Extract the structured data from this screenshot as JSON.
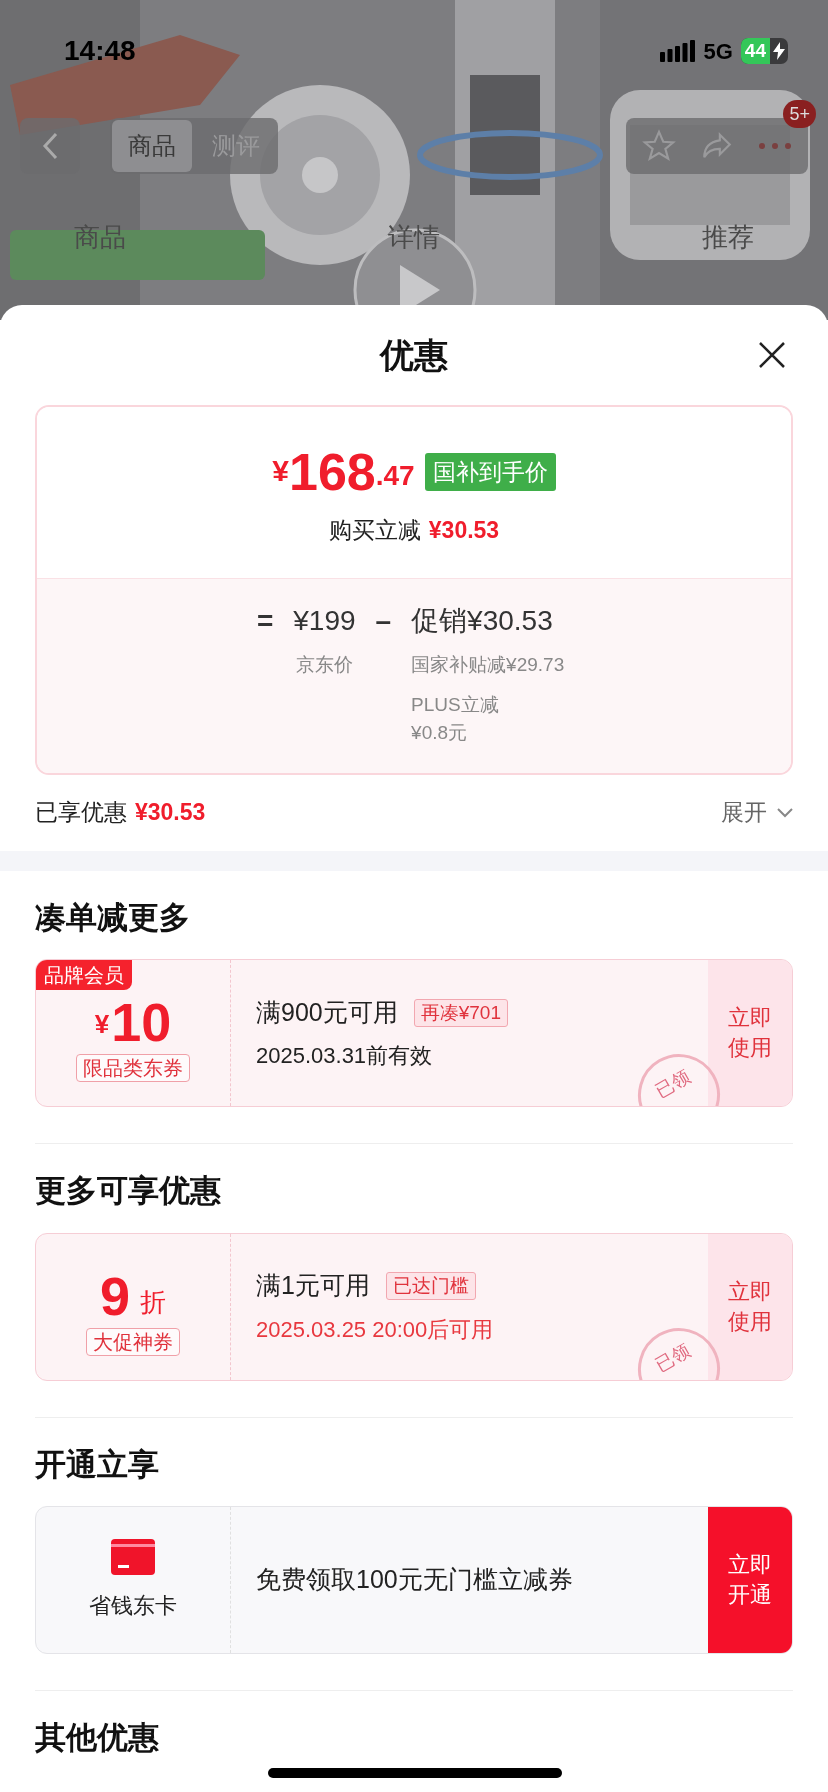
{
  "status_bar": {
    "time": "14:48",
    "network": "5G",
    "battery": "44",
    "charging": true
  },
  "product_header": {
    "tabs": [
      {
        "label": "商品",
        "selected": true
      },
      {
        "label": "测评",
        "selected": false
      }
    ],
    "badge": "5+",
    "nav": [
      {
        "label": "商品"
      },
      {
        "label": "详情"
      },
      {
        "label": "推荐"
      }
    ]
  },
  "sheet": {
    "title": "优惠",
    "price": {
      "currency": "¥",
      "integer": "168",
      "decimal": ".47",
      "tag": "国补到手价",
      "saving_label": "购买立减",
      "saving_value": "¥30.53"
    },
    "breakdown": {
      "equals": "=",
      "base_value": "¥199",
      "base_label": "京东价",
      "minus": "–",
      "promo": "促销¥30.53",
      "details": [
        {
          "lines": [
            "国家补贴减¥29.73"
          ]
        },
        {
          "lines": [
            "PLUS立减",
            "¥0.8元"
          ]
        }
      ]
    },
    "summary": {
      "label": "已享优惠",
      "value": "¥30.53",
      "toggle": "展开"
    },
    "sections": [
      {
        "title": "凑单减更多",
        "cards": [
          {
            "kind": "coupon",
            "ribbon": "品牌会员",
            "prefix": "¥",
            "value": "10",
            "tag": "限品类东券",
            "condition": "满900元可用",
            "chip": "再凑¥701",
            "validity": "2025.03.31前有效",
            "validity_highlight": false,
            "button": [
              "立即",
              "使用"
            ],
            "stamp": "已领"
          }
        ]
      },
      {
        "title": "更多可享优惠",
        "cards": [
          {
            "kind": "coupon",
            "value": "9",
            "suffix": "折",
            "tag": "大促神券",
            "condition": "满1元可用",
            "chip": "已达门槛",
            "validity": "2025.03.25 20:00后可用",
            "validity_highlight": true,
            "button": [
              "立即",
              "使用"
            ],
            "stamp": "已领"
          }
        ]
      },
      {
        "title": "开通立享",
        "cards": [
          {
            "kind": "membership",
            "name": "省钱东卡",
            "text": "免费领取100元无门槛立减券",
            "button": [
              "立即",
              "开通"
            ]
          }
        ]
      },
      {
        "title": "其他优惠"
      }
    ]
  }
}
